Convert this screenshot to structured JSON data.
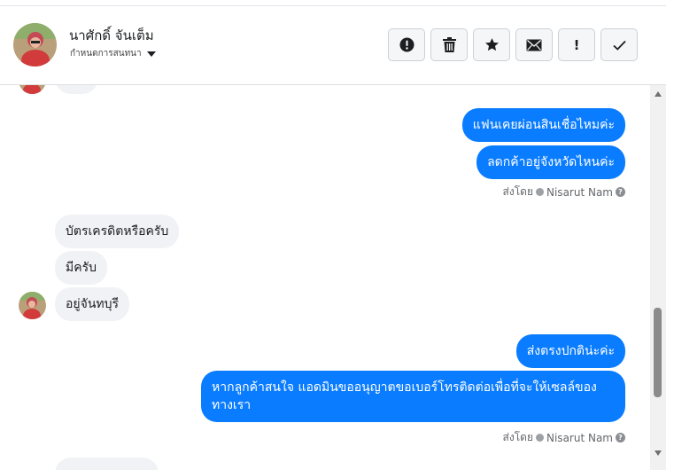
{
  "header": {
    "contact_name": "นาศักดิ์ จันเต็ม",
    "conversation_settings": "กำหนดการสนทนา"
  },
  "toolbar": {
    "spam_icon": "exclamation-circle-icon",
    "delete_icon": "trash-icon",
    "star_icon": "star-icon",
    "mail_icon": "envelope-icon",
    "follow_up_label": "!",
    "done_icon": "check-icon"
  },
  "messages": [
    {
      "side": "in",
      "text": ""
    },
    {
      "side": "out",
      "text": "แฟนเคยผ่อนสินเชื่อไหมค่ะ"
    },
    {
      "side": "out",
      "text": "ลดกค้าอยู่จังหวัดไหนค่ะ"
    },
    {
      "side": "in",
      "text": "บัตรเครดิตหรือครับ"
    },
    {
      "side": "in",
      "text": "มีครับ"
    },
    {
      "side": "in",
      "text": "อยู่จันทบุรี"
    },
    {
      "side": "out",
      "text": "ส่งตรงปกติน่ะค่ะ"
    },
    {
      "side": "out",
      "text": "หากลูกค้าสนใจ แอดมินขออนุญาตขอเบอร์โทรติดต่อเพื่อที่จะให้เซลล์ของทางเรา"
    },
    {
      "side": "in",
      "text": ""
    }
  ],
  "sent_by": {
    "prefix": "ส่งโดย",
    "name": "Nisarut Nam",
    "help": "?"
  },
  "colors": {
    "outgoing_bubble": "#0a7cff",
    "incoming_bubble": "#f0f2f5"
  }
}
